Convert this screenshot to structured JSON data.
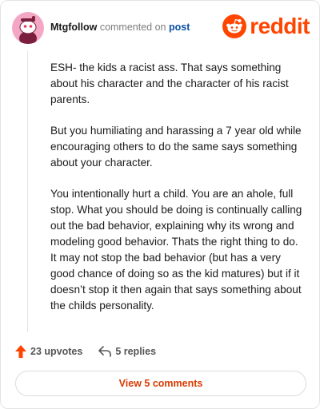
{
  "comment": {
    "username": "Mtgfollow",
    "commented_on": "commented on",
    "post_link": "post",
    "paragraphs": [
      "ESH- the kids a racist ass. That says something about his character and the character of his racist parents.",
      "But you humiliating and harassing a 7 year old while encouraging others to do the same says something about your character.",
      "You intentionally hurt a child. You are an ahole, full stop.  What you should be doing is continually calling out the bad behavior, explaining why its wrong and modeling good behavior.  Thats the right thing to do. It may not stop the bad behavior (but has a very good chance of doing so as the kid matures) but if it doesn’t stop it then again that says something about the childs personality."
    ]
  },
  "brand": {
    "logo_text": "reddit",
    "color": "#ff4500"
  },
  "actions": {
    "upvotes": "23 upvotes",
    "replies": "5 replies",
    "view_comments": "View 5 comments"
  },
  "icons": {
    "upvote": "upvote-arrow-icon",
    "reply": "reply-arrow-icon",
    "logo": "reddit-alien-icon",
    "avatar": "snoo-avatar-icon"
  },
  "colors": {
    "accent": "#ff4500",
    "link": "#0b4fa3",
    "button_text": "#d93a00",
    "avatar_bg": "#f4a7c5"
  }
}
